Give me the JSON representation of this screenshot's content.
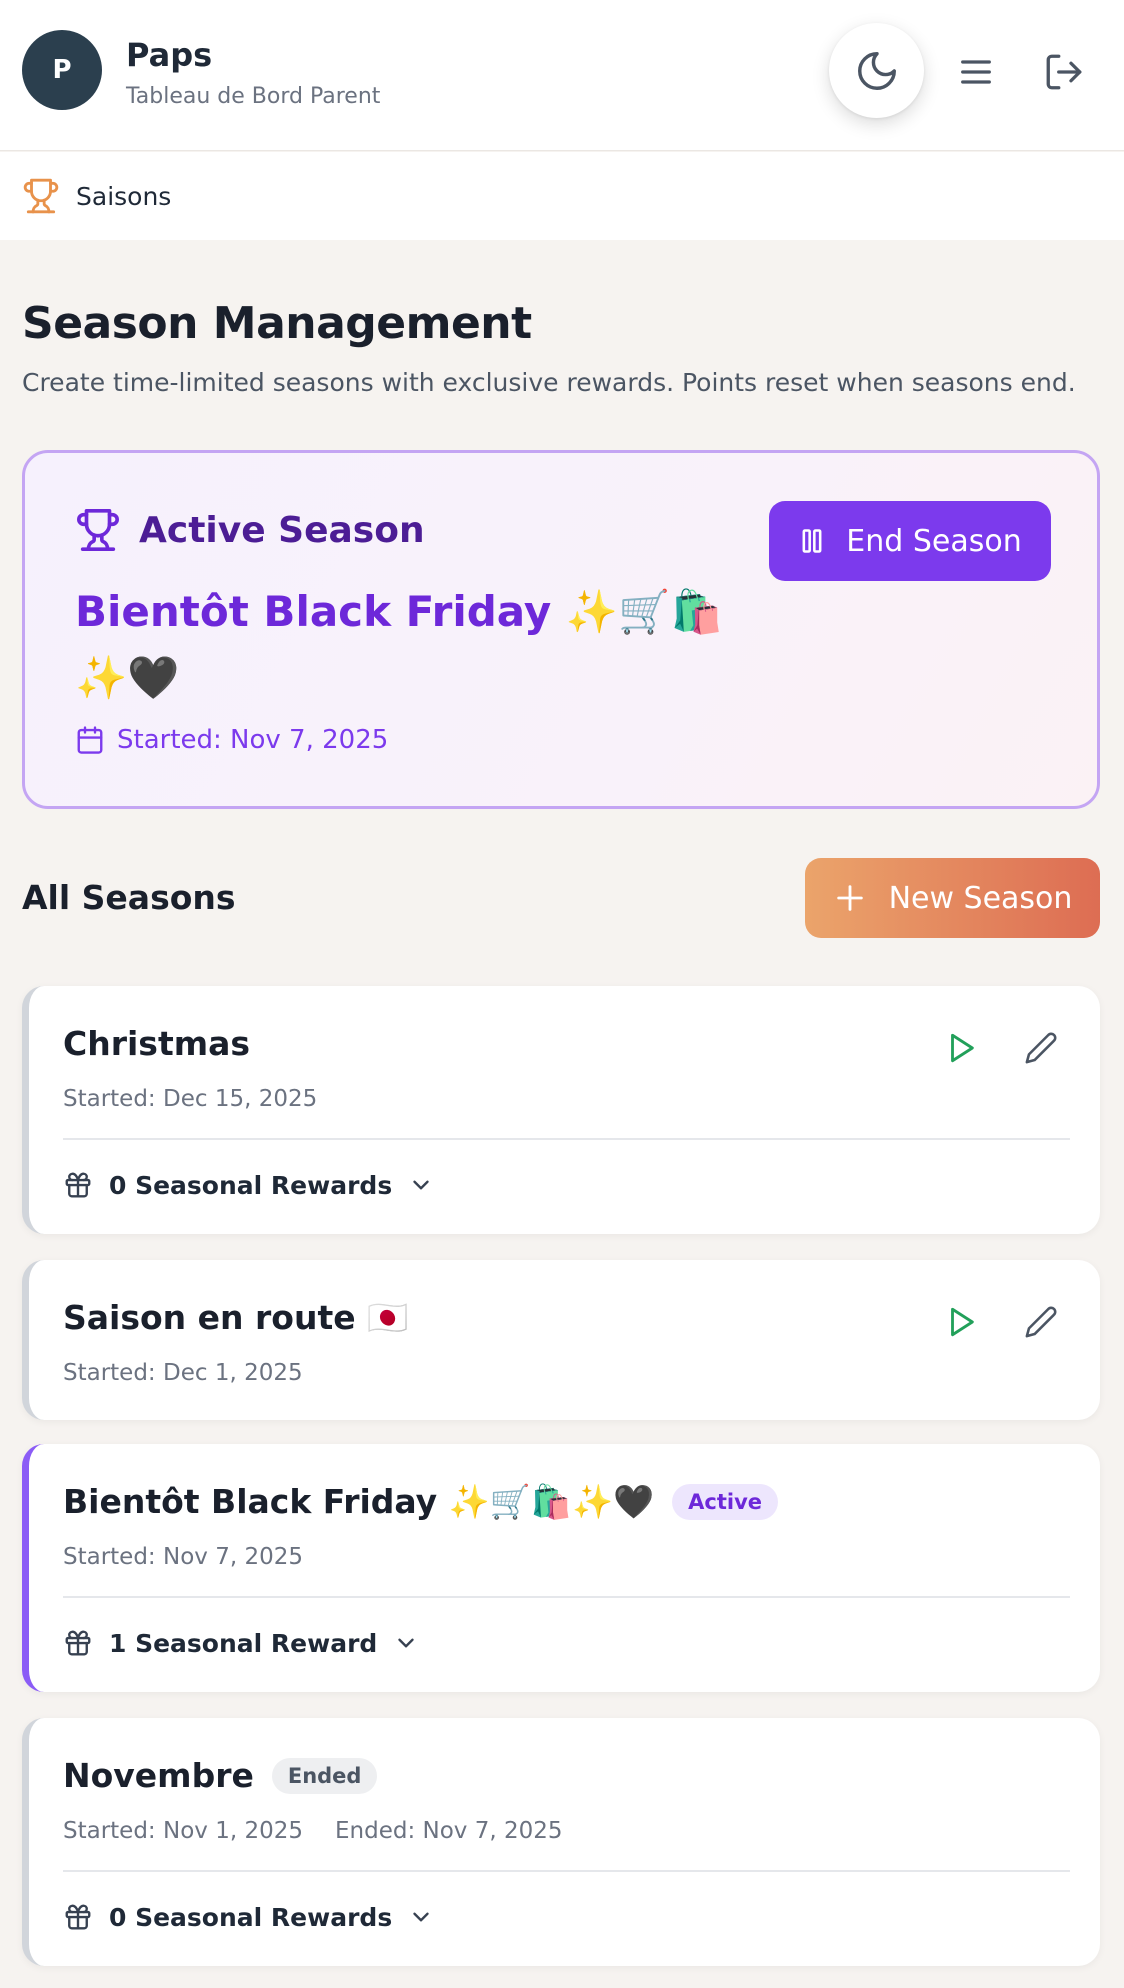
{
  "user": {
    "initial": "P",
    "name": "Paps",
    "subtitle": "Tableau de Bord Parent"
  },
  "nav": {
    "current": "Saisons"
  },
  "page": {
    "title": "Season Management",
    "description": "Create time-limited seasons with exclusive rewards. Points reset when seasons end."
  },
  "active_season": {
    "heading": "Active Season",
    "name": "Bientôt Black Friday ✨🛒🛍️✨🖤",
    "started": "Started: Nov 7, 2025",
    "end_button": "End Season"
  },
  "all_seasons": {
    "title": "All Seasons",
    "new_button": "New Season",
    "items": [
      {
        "name": "Christmas",
        "started": "Started: Dec 15, 2025",
        "rewards": "0 Seasonal Rewards"
      },
      {
        "name": "Saison en route 🇯🇵",
        "started": "Started: Dec 1, 2025"
      },
      {
        "name": "Bientôt Black Friday ✨🛒🛍️✨🖤",
        "badge": "Active",
        "started": "Started: Nov 7, 2025",
        "rewards": "1 Seasonal Reward"
      },
      {
        "name": "Novembre",
        "badge": "Ended",
        "started": "Started: Nov 1, 2025",
        "ended": "Ended: Nov 7, 2025",
        "rewards": "0 Seasonal Rewards"
      }
    ]
  },
  "icons": {
    "theme": "moon-icon",
    "menu": "menu-icon",
    "logout": "logout-icon",
    "nav": "trophy-icon",
    "calendar": "calendar-icon",
    "pause": "pause-icon",
    "plus": "plus-icon",
    "play": "play-icon",
    "edit": "pencil-icon",
    "gift": "gift-icon",
    "chevron": "chevron-down-icon"
  },
  "colors": {
    "accent_purple": "#7c3aed",
    "play_green": "#22a05a",
    "orange_start": "#eba46b",
    "orange_end": "#dd6d53",
    "avatar_bg": "#2b3f4e",
    "trophy_orange": "#e8924b"
  }
}
